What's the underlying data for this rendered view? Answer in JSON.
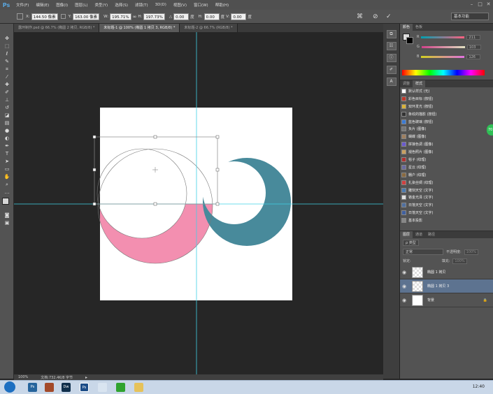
{
  "app": {
    "logo": "Ps"
  },
  "menu": {
    "items": [
      "文件(F)",
      "编辑(E)",
      "图像(I)",
      "图层(L)",
      "类型(Y)",
      "选择(S)",
      "滤镜(T)",
      "3D(D)",
      "视图(V)",
      "窗口(W)",
      "帮助(H)"
    ]
  },
  "options": {
    "x_label": "X:",
    "x_value": "144.50 像素",
    "y_label": "Y:",
    "y_value": "163.00 像素",
    "w_label": "W:",
    "w_value": "195.71%",
    "h_label": "H:",
    "h_value": "197.73%",
    "angle_label": "△",
    "angle_value": "0.00",
    "angle_unit": "度",
    "hskew_label": "H:",
    "hskew_value": "0.00",
    "hskew_unit": "度",
    "vskew_label": "V:",
    "vskew_value": "0.00",
    "vskew_unit": "度",
    "workspace": "基本功能"
  },
  "tabs": [
    {
      "label": "露环制作.psd @ 66.7% (椭圆 2 拷贝, RGB/8) *",
      "active": false
    },
    {
      "label": "未标题-1 @ 100% (椭圆 1 拷贝 3, RGB/8) *",
      "active": true
    },
    {
      "label": "未标题-2 @ 66.7% (RGB/8) *",
      "active": false
    }
  ],
  "toolbar": {
    "tools": [
      "move-tool",
      "marquee-tool",
      "lasso-tool",
      "quick-select-tool",
      "crop-tool",
      "eyedropper-tool",
      "healing-brush-tool",
      "brush-tool",
      "clone-stamp-tool",
      "history-brush-tool",
      "eraser-tool",
      "gradient-tool",
      "blur-tool",
      "dodge-tool",
      "pen-tool",
      "type-tool",
      "path-select-tool",
      "shape-tool",
      "hand-tool",
      "zoom-tool"
    ]
  },
  "status": {
    "zoom": "100%",
    "doc_info": "文档:732.4K/8 字节"
  },
  "color_panel": {
    "tabs": [
      "颜色",
      "色板"
    ],
    "r_label": "R",
    "r_value": "211",
    "g_label": "G",
    "g_value": "103",
    "b_label": "B",
    "b_value": "126"
  },
  "styles_panel": {
    "tabs": [
      "调整",
      "样式"
    ],
    "items": [
      "默认样式 (无)",
      "彩色目标 (按钮)",
      "双环发光 (按钮)",
      "条纹的描影 (按钮)",
      "蓝色玻璃 (按钮)",
      "负片 (图像)",
      "蝴蝶 (图像)",
      "拼接色调 (图像)",
      "褪色照片 (图像)",
      "毯子 (纹理)",
      "星云 (纹理)",
      "棚户 (纹理)",
      "扎染丝绸 (纹理)",
      "雕刻天空 (文字)",
      "铬金光泽 (文字)",
      "日落天空 (文字)",
      "日落天空 (文字)",
      "基本投影"
    ],
    "swatches": [
      "#ffffff",
      "#c0392b",
      "#d9b23a",
      "#333333",
      "#3a7bd5",
      "#777777",
      "#a08060",
      "#6a5acd",
      "#c9a060",
      "#b03030",
      "#6a6aa0",
      "#8a6a40",
      "#d04040",
      "#4a7ab0",
      "#e0e0e0",
      "#5070a0",
      "#4060a0",
      "#888888"
    ]
  },
  "layers_panel": {
    "tabs": [
      "图层",
      "通道",
      "路径"
    ],
    "filter_label": "ρ 类型",
    "blend_mode": "正常",
    "opacity_label": "不透明度:",
    "opacity_value": "100%",
    "lock_label": "锁定:",
    "fill_label": "填充:",
    "fill_value": "100%",
    "layers": [
      {
        "name": "椭圆 1 拷贝",
        "active": false
      },
      {
        "name": "椭圆 1 拷贝 3",
        "active": true
      },
      {
        "name": "背景",
        "active": false
      }
    ]
  },
  "taskbar": {
    "time": "12:40",
    "badge": "70"
  },
  "colors": {
    "accent": "#5d7390",
    "pink": "#f38fb0",
    "teal": "#488a9b",
    "guide": "#3fd0e6"
  }
}
